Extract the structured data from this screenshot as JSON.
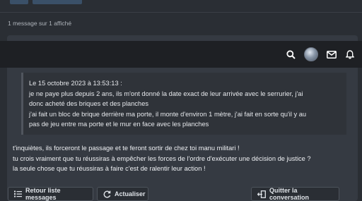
{
  "topbar": {
    "icons": [
      "search-icon",
      "avatar",
      "mail-icon",
      "bell-icon"
    ]
  },
  "message_count": "1 message sur 1 affiché",
  "quote": {
    "header": "Le 15 octobre 2023 à 13:53:13 :",
    "lines": [
      "je ne paye plus depuis 2 ans, ils m'ont donné la date exact de leur arrivée avec le serrurier, j'ai",
      "donc acheté des briques et des planches",
      "j'ai fait un bloc de brique derrière ma porte, il monte d'environ 1 mètre, j'ai fait en sorte qu'il y au",
      "pas de jeu entre ma porte et le mur en face avec les planches"
    ]
  },
  "reply": {
    "lines": [
      "t'inquiètes, ils forceront le passage et te feront sortir de chez toi manu militari !",
      "tu crois vraiment que tu réussiras à empêcher les forces de l'ordre d'exécuter une décision de justice ?",
      "la seule chose que tu réussiras à faire c'est de ralentir leur action !"
    ]
  },
  "actions": {
    "back_label": "Retour liste messages",
    "refresh_label": "Actualiser",
    "leave_label": "Quitter la conversation"
  },
  "colors": {
    "background": "#2a2e34",
    "card": "#353a42",
    "header_bar": "#1e2024",
    "quote_bg": "#2f3339"
  }
}
